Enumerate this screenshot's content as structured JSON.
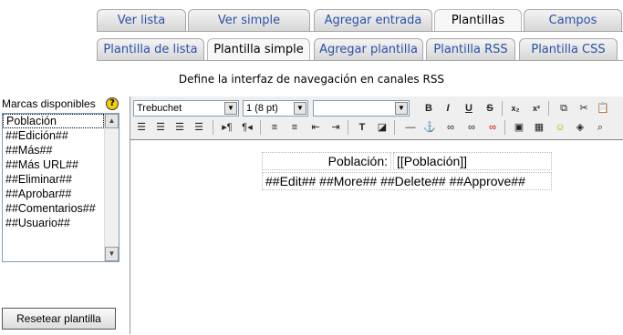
{
  "tabs_top": [
    "Ver lista",
    "Ver simple",
    "Agregar entrada",
    "Plantillas",
    "Campos"
  ],
  "tabs_top_active": "Plantillas",
  "tabs_sub": [
    "Plantilla de lista",
    "Plantilla simple",
    "Agregar plantilla",
    "Plantilla RSS",
    "Plantilla CSS"
  ],
  "tabs_sub_active": "Plantilla simple",
  "description": "Define la interfaz de navegación en canales RSS",
  "sidebar": {
    "title": "Marcas disponibles",
    "help_icon": "?",
    "tags": [
      "Población",
      "##Edición##",
      "##Más##",
      "##Más URL##",
      "##Eliminar##",
      "##Aprobar##",
      "##Comentarios##",
      "##Usuario##"
    ],
    "reset_button": "Resetear plantilla"
  },
  "editor": {
    "font_value": "Trebuchet",
    "size_value": "1 (8 pt)",
    "format_value": "",
    "table": {
      "row1_label": "Población:",
      "row1_value": "[[Población]]",
      "row2": "##Edit## ##More## ##Delete## ##Approve##"
    }
  },
  "colors": {
    "tab_link": "#2a51a8",
    "border": "#a8a8a8"
  }
}
